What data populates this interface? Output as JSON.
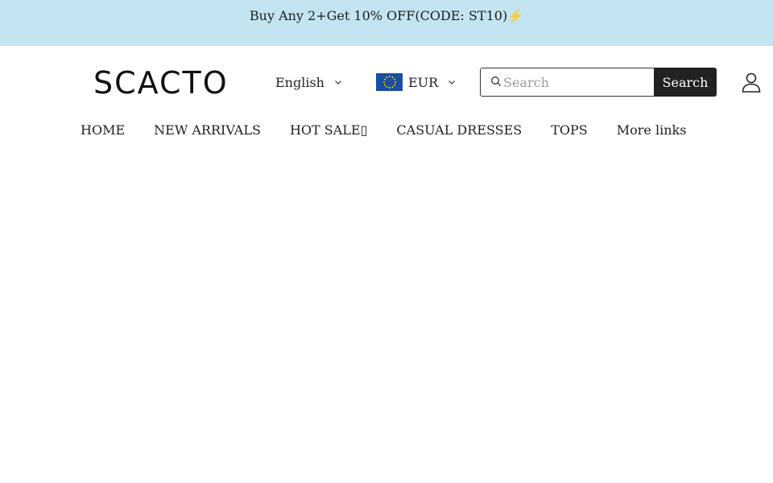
{
  "announcement": {
    "text": "Buy Any 2+Get 10% OFF(CODE: ST10)⚡"
  },
  "header": {
    "logo_text": "SCACTO",
    "language": {
      "selected": "English",
      "icon": "chevron-down-icon"
    },
    "currency": {
      "selected": "EUR",
      "flag_icon": "eu-flag-icon",
      "icon": "chevron-down-icon"
    },
    "search": {
      "placeholder": "Search",
      "value": "",
      "button_label": "Search",
      "icon": "search-icon"
    },
    "account_icon": "user-icon"
  },
  "nav": {
    "items": [
      {
        "label": "HOME"
      },
      {
        "label": "NEW ARRIVALS"
      },
      {
        "label": "HOT SALE▯"
      },
      {
        "label": "CASUAL DRESSES"
      },
      {
        "label": "TOPS"
      },
      {
        "label": "More links"
      }
    ]
  },
  "colors": {
    "announcement_bg": "#c3e4f0",
    "search_button_bg": "#222222",
    "flag_blue": "#1a4fa0",
    "flag_star": "#f5d300"
  }
}
